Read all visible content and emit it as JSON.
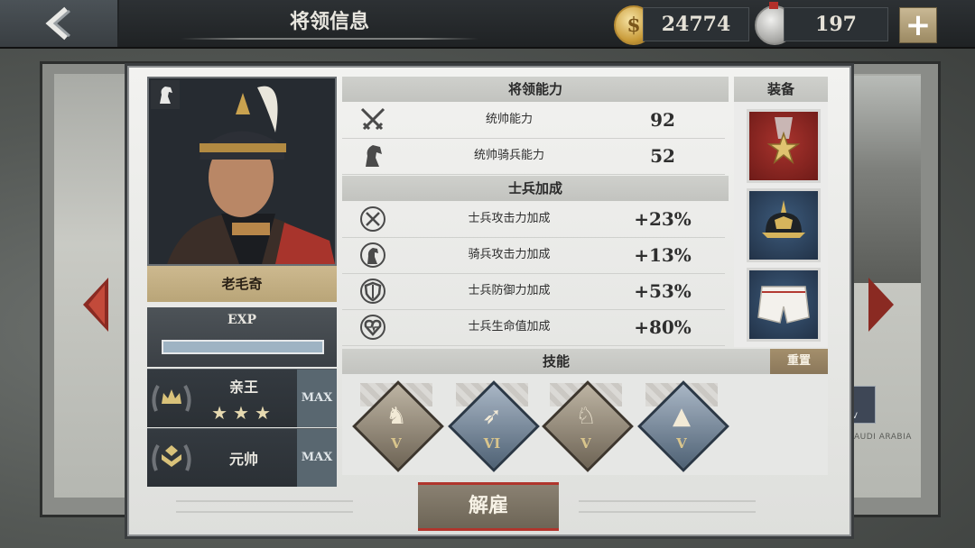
{
  "header": {
    "title": "将领信息",
    "gold": "24774",
    "medals": "197"
  },
  "general": {
    "name": "老毛奇",
    "exp_label": "EXP",
    "exp_progress": 1.0,
    "ranks": [
      {
        "name": "亲王",
        "stars": "★★★",
        "max": "MAX"
      },
      {
        "name": "元帅",
        "max": "MAX"
      }
    ]
  },
  "abilities": {
    "title": "将领能力",
    "rows": [
      {
        "icon": "crossed-swords-icon",
        "label": "统帅能力",
        "value": "92"
      },
      {
        "icon": "horse-head-icon",
        "label": "统帅骑兵能力",
        "value": "52"
      }
    ]
  },
  "bonuses": {
    "title": "士兵加成",
    "rows": [
      {
        "icon": "sword-up-icon",
        "label": "士兵攻击力加成",
        "value": "+23%"
      },
      {
        "icon": "horse-up-icon",
        "label": "骑兵攻击力加成",
        "value": "+13%"
      },
      {
        "icon": "shield-up-icon",
        "label": "士兵防御力加成",
        "value": "+53%"
      },
      {
        "icon": "heart-up-icon",
        "label": "士兵生命值加成",
        "value": "+80%"
      }
    ]
  },
  "equipment": {
    "title": "装备",
    "items": [
      "medal-icon",
      "pickelhaube-helmet-icon",
      "white-trousers-icon"
    ]
  },
  "skills": {
    "title": "技能",
    "reset_label": "重置",
    "items": [
      {
        "icon": "cavalry-charge-icon",
        "level": "V",
        "color": "brown"
      },
      {
        "icon": "flanking-arrow-icon",
        "level": "VI",
        "color": "blue"
      },
      {
        "icon": "cavalry-rider-icon",
        "level": "V",
        "color": "brown"
      },
      {
        "icon": "mountains-icon",
        "level": "V",
        "color": "blue"
      }
    ]
  },
  "actions": {
    "dismiss_label": "解雇"
  },
  "map": {
    "region_label": "AUDI ARABIA",
    "badge_text": "IV"
  }
}
